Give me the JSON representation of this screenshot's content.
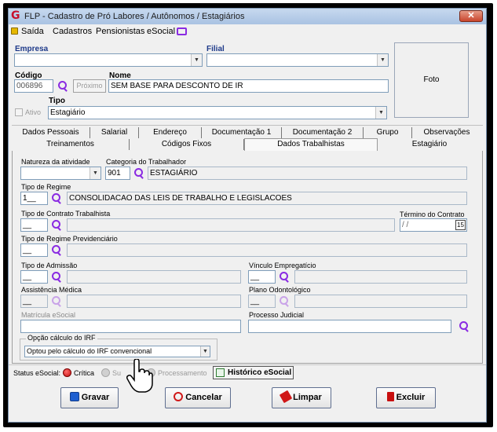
{
  "window": {
    "title": "FLP - Cadastro de Pró Labores / Autônomos / Estagiários",
    "close": "✕",
    "app_icon": "G"
  },
  "menu": {
    "items": [
      "Saída",
      "Cadastros",
      "Pensionistas",
      "eSocial"
    ]
  },
  "header": {
    "empresa_label": "Empresa",
    "empresa_value": "",
    "filial_label": "Filial",
    "filial_value": "",
    "codigo_label": "Código",
    "codigo_value": "006896",
    "proximo_label": "Próximo",
    "nome_label": "Nome",
    "nome_value": "SEM BASE PARA DESCONTO DE IR",
    "ativo_label": "Ativo",
    "tipo_label": "Tipo",
    "tipo_value": "Estagiário",
    "foto_label": "Foto"
  },
  "tabs": {
    "row1": [
      "Dados Pessoais",
      "Salarial",
      "Endereço",
      "Documentação 1",
      "Documentação 2",
      "Grupo",
      "Observações"
    ],
    "row2": [
      "Treinamentos",
      "Códigos Fixos",
      "Dados Trabalhistas",
      "Estagiário"
    ],
    "active": "Dados Trabalhistas"
  },
  "form": {
    "natureza_label": "Natureza da atividade",
    "natureza_value": "",
    "categoria_label": "Categoria do Trabalhador",
    "categoria_code": "901",
    "categoria_desc": "ESTAGIÁRIO",
    "tipo_regime_label": "Tipo de Regime",
    "tipo_regime_code": "1__",
    "tipo_regime_desc": "CONSOLIDACAO DAS LEIS DE TRABALHO E LEGISLACOES",
    "tipo_contrato_label": "Tipo de Contrato Trabalhista",
    "tipo_contrato_code": "__",
    "termino_label": "Término do Contrato",
    "termino_value": " / /",
    "termino_btn": "15",
    "regime_prev_label": "Tipo de Regime Previdenciário",
    "regime_prev_code": "__",
    "tipo_admissao_label": "Tipo de Admissão",
    "tipo_admissao_code": "__",
    "vinculo_label": "Vínculo Empregatício",
    "vinculo_code": "__",
    "assistencia_label": "Assistência Médica",
    "assistencia_code": "__",
    "odonto_label": "Plano Odontológico",
    "odonto_code": "__",
    "matricula_label": "Matrícula eSocial",
    "matricula_value": "",
    "processo_label": "Processo Judicial",
    "processo_value": "",
    "irf_group_label": "Opção cálculo do IRF",
    "irf_value": "Optou pelo cálculo do IRF convencional"
  },
  "status": {
    "label": "Status eSocial:",
    "critica": "Crítica",
    "sucesso": "Su",
    "processamento": "Processamento",
    "historico": "Histórico eSocial"
  },
  "buttons": {
    "gravar": "Gravar",
    "cancelar": "Cancelar",
    "limpar": "Limpar",
    "excluir": "Excluir"
  },
  "colors": {
    "accent": "#1e3a8a",
    "purple_icon": "#8a2be2",
    "critica_red": "#d32020",
    "title_red": "#c8102e"
  }
}
